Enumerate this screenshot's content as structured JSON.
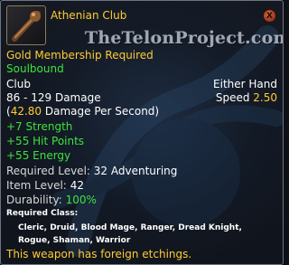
{
  "item": {
    "name": "Athenian Club",
    "watermark": "TheTelonProject.com",
    "membership": "Gold Membership Required",
    "binding": "Soulbound",
    "type": "Club",
    "slot": "Either Hand",
    "speed_label": "Speed",
    "speed_value": "2.50",
    "damage": "86 - 129 Damage",
    "dps_value": "42.80",
    "dps_suffix": " Damage Per Second)",
    "dps_prefix": "(",
    "stats": [
      "+7 Strength",
      "+55 Hit Points",
      "+55 Energy"
    ],
    "required_level_label": "Required Level:",
    "required_level_value": "32 Adventuring",
    "item_level_label": "Item Level:",
    "item_level_value": "42",
    "durability_label": "Durability:",
    "durability_value": "100%",
    "required_class_label": "Required Class:",
    "required_class_lines": [
      "Cleric, Druid, Blood Mage, Ranger, Dread Knight,",
      "Rogue, Shaman, Warrior"
    ],
    "flavor": "This weapon has foreign etchings."
  },
  "close_label": "X",
  "icons": {
    "item": "club-icon",
    "close": "close-icon"
  },
  "colors": {
    "title": "#ffcc33",
    "bonus": "#3ee23e",
    "text": "#ffffff",
    "background": "#10141c"
  }
}
